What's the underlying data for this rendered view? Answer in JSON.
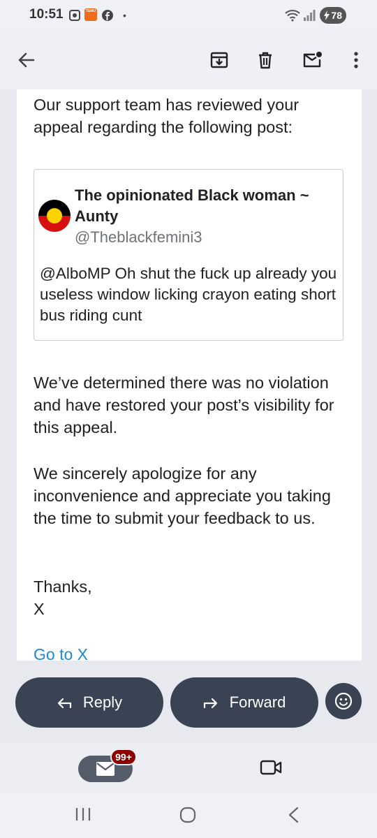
{
  "status_bar": {
    "time": "10:51",
    "temu_label": "TEMU",
    "dot": "•",
    "battery": "78",
    "icons": [
      "screenshot-icon",
      "temu-icon",
      "facebook-icon",
      "wifi-icon",
      "signal-icon",
      "battery-icon"
    ]
  },
  "toolbar": {
    "icons": [
      "back-arrow-icon",
      "archive-icon",
      "delete-icon",
      "mark-unread-icon",
      "more-vert-icon"
    ]
  },
  "email": {
    "intro": "Our support team has reviewed your appeal regarding the following post:",
    "tweet": {
      "name": "The opinionated Black woman ~ Aunty",
      "handle": "@Theblackfemini3",
      "text": "@AlboMP Oh shut the fuck up already you useless window licking crayon eating short bus riding cunt"
    },
    "determination": "We’ve determined there was no violation and have restored your post’s visibility for this appeal.",
    "apology": "We sincerely apologize for any inconvenience and appreciate you taking the time to submit your feedback to us.",
    "sign_off_1": "Thanks,",
    "sign_off_2": "X",
    "link": "Go to X"
  },
  "actions": {
    "reply_label": "Reply",
    "forward_label": "Forward"
  },
  "bottom_nav": {
    "mail_badge": "99+"
  },
  "colors": {
    "pill": "#3a4354",
    "link": "#1a8cd8",
    "badge": "#8b0000",
    "background": "#e8e9ef"
  }
}
